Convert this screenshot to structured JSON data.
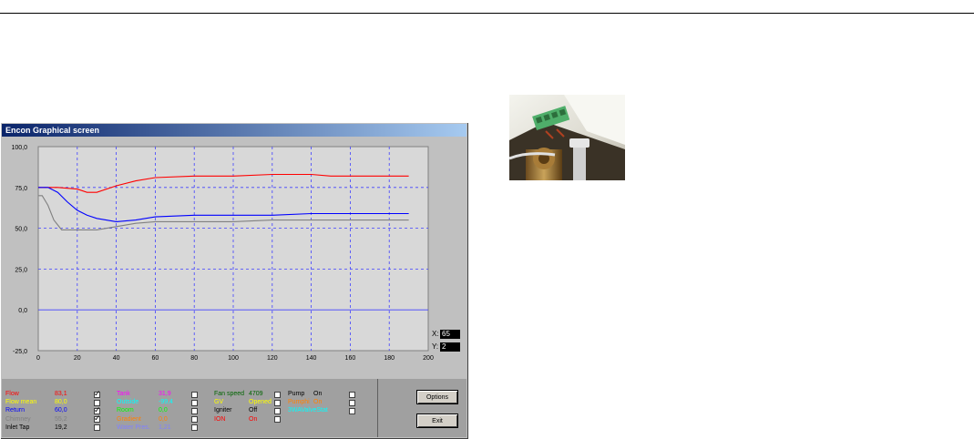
{
  "window": {
    "title": "Encon Graphical screen"
  },
  "chart_data": {
    "type": "line",
    "xlim": [
      0,
      200
    ],
    "ylim": [
      -25,
      100
    ],
    "x_ticks": [
      "0",
      "20",
      "40",
      "60",
      "80",
      "100",
      "120",
      "140",
      "160",
      "180",
      "200"
    ],
    "y_ticks": [
      "100,0",
      "75,0",
      "50,0",
      "25,0",
      "0,0",
      "-25,0"
    ],
    "grid": true,
    "series": [
      {
        "color": "#ff0000",
        "x": [
          0,
          10,
          20,
          25,
          30,
          40,
          50,
          60,
          80,
          100,
          120,
          140,
          150,
          160,
          190
        ],
        "y": [
          75,
          75,
          74,
          72,
          72,
          76,
          79,
          81,
          82,
          82,
          83,
          83,
          82,
          82,
          82
        ]
      },
      {
        "color": "#0000ff",
        "x": [
          0,
          5,
          10,
          15,
          20,
          25,
          30,
          40,
          50,
          60,
          80,
          100,
          120,
          140,
          150,
          160,
          190
        ],
        "y": [
          75,
          75,
          72,
          66,
          61,
          58,
          56,
          54,
          55,
          57,
          58,
          58,
          58,
          59,
          59,
          59,
          59
        ]
      },
      {
        "color": "#808080",
        "x": [
          0,
          2,
          5,
          8,
          12,
          20,
          30,
          40,
          50,
          60,
          80,
          100,
          120,
          140,
          160,
          190
        ],
        "y": [
          70,
          70,
          64,
          55,
          49,
          49,
          49,
          51,
          53,
          54,
          54,
          54,
          55,
          55,
          55,
          55
        ]
      }
    ]
  },
  "xy": {
    "x_label": "X:",
    "x_value": "65",
    "y_label": "Y:",
    "y_value": "2"
  },
  "legend": {
    "col1": [
      {
        "label": "Flow",
        "value": "83,1",
        "color": "#ff0000",
        "checked": true
      },
      {
        "label": "Flow mean",
        "value": "80,0",
        "color": "#ffff00",
        "checked": false
      },
      {
        "label": "Return",
        "value": "60,0",
        "color": "#0000ff",
        "checked": true
      },
      {
        "label": "Chimney",
        "value": "55,2",
        "color": "#808080",
        "checked": true
      },
      {
        "label": "Inlet Tap",
        "value": "19,2",
        "color": "#000000",
        "checked": false
      }
    ],
    "col2": [
      {
        "label": "Tank",
        "value": "31,9",
        "color": "#ff00ff"
      },
      {
        "label": "Outside",
        "value": "-99,4",
        "color": "#00ffff"
      },
      {
        "label": "Room",
        "value": "0,0",
        "color": "#00ff00"
      },
      {
        "label": "Gradient",
        "value": "0,0",
        "color": "#ff8000"
      },
      {
        "label": "Water Pres.",
        "value": "1,21",
        "color": "#8080ff"
      }
    ],
    "col3": [
      {
        "label": "Fan speed",
        "value": "4709",
        "color": "#006400"
      },
      {
        "label": "GV",
        "value": "Opened",
        "color": "#ffff00"
      },
      {
        "label": "Igniter",
        "value": "Off",
        "color": "#000000"
      },
      {
        "label": "ION",
        "value": "On",
        "color": "#ff0000"
      }
    ],
    "col4": [
      {
        "label": "Pump",
        "value": "On",
        "color": "#000000"
      },
      {
        "label": "Pumphi",
        "value": "On",
        "color": "#ff8000"
      },
      {
        "label": "3WAValveStat",
        "value": "",
        "color": "#00ffff"
      }
    ]
  },
  "buttons": {
    "options": "Options",
    "exit": "Exit"
  }
}
